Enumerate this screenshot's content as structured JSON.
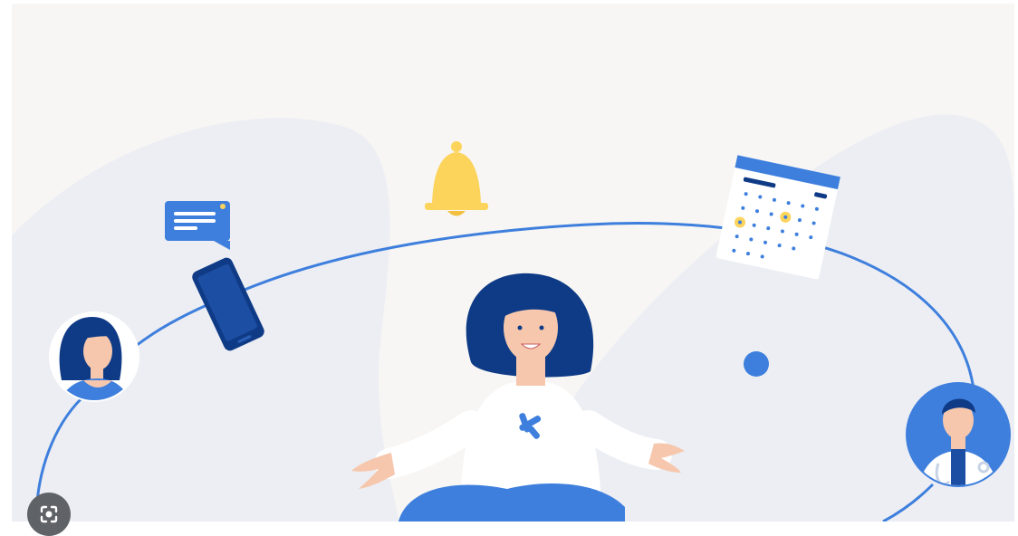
{
  "illustration": {
    "scene": "scene-illustration",
    "colors": {
      "background": "#f7f6f4",
      "blob": "#eceef3",
      "orbit_line": "#3e7fdd",
      "navy": "#0f3b86",
      "accent_blue": "#3e7fdd",
      "yellow": "#fcd45c",
      "skin": "#f6c7ad",
      "white": "#ffffff"
    },
    "elements": [
      {
        "name": "chat-bubble-icon",
        "interactable": false
      },
      {
        "name": "bell-icon",
        "interactable": false
      },
      {
        "name": "smartphone-icon",
        "interactable": false
      },
      {
        "name": "calendar-icon",
        "interactable": false
      },
      {
        "name": "woman-avatar",
        "interactable": false
      },
      {
        "name": "meditating-woman",
        "interactable": false
      },
      {
        "name": "doctor-avatar",
        "interactable": false
      },
      {
        "name": "blue-dot",
        "interactable": false
      }
    ]
  },
  "overlay": {
    "lens_icon": "lens-camera-icon"
  }
}
